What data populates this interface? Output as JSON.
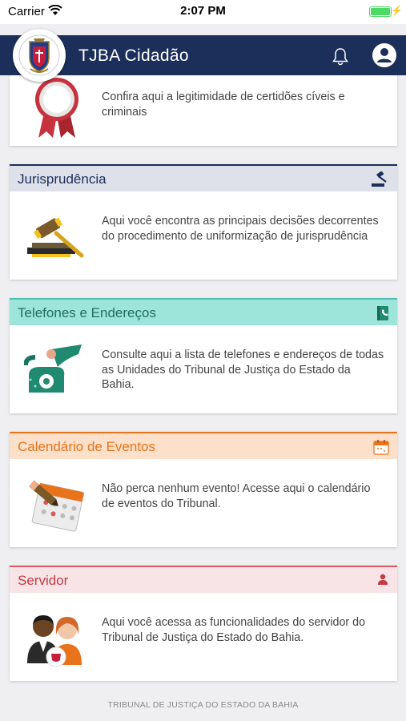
{
  "status_bar": {
    "carrier": "Carrier",
    "time": "2:07 PM"
  },
  "navbar": {
    "title": "TJBA Cidadão",
    "icons": [
      "bell-icon",
      "user-account-icon"
    ],
    "color": "#1b2f5a"
  },
  "cards": [
    {
      "id": "certidoes",
      "title": "",
      "description": "Confira aqui a legitimidade de certidões cíveis e criminais",
      "icon": "award-ribbon-icon"
    },
    {
      "id": "jurisprudencia",
      "title": "Jurisprudência",
      "description": "Aqui você encontra as principais decisões decorrentes do procedimento de uniformização de jurisprudência",
      "icon": "gavel-icon",
      "color": "#1b2f5a"
    },
    {
      "id": "telefones",
      "title": "Telefones e Endereços",
      "description": "Consulte aqui a lista de telefones e endereços de todas as Unidades do Tribunal de Justiça do Estado da Bahia.",
      "icon": "phone-book-icon",
      "color": "#1f8a70"
    },
    {
      "id": "calendario",
      "title": "Calendário de Eventos",
      "description": "Não perca nenhum evento! Acesse aqui o calendário de eventos do Tribunal.",
      "icon": "calendar-icon",
      "color": "#e8731a"
    },
    {
      "id": "servidor",
      "title": "Servidor",
      "description": "Aqui você acessa as funcionalidades do servidor do Tribunal de Justiça do Estado do Bahia.",
      "icon": "person-icon",
      "color": "#c33a44"
    }
  ],
  "footer": "TRIBUNAL DE JUSTIÇA DO ESTADO DA BAHIA"
}
